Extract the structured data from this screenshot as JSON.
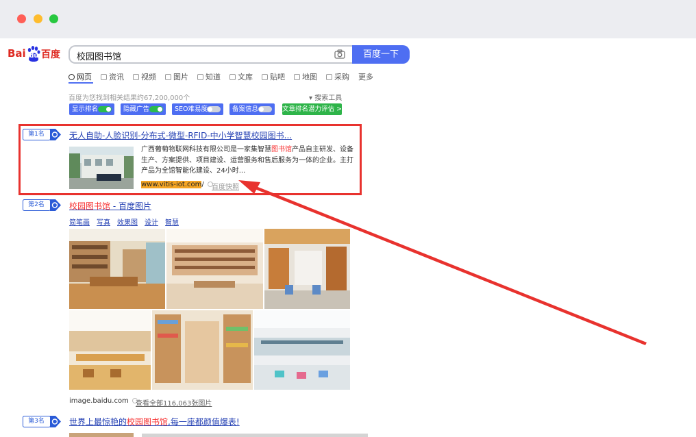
{
  "window": {
    "controls": [
      "close",
      "minimize",
      "zoom"
    ]
  },
  "logo": {
    "text_bai": "Bai",
    "text_du": "du",
    "text_baidu_cn": "百度"
  },
  "search": {
    "query": "校园图书馆",
    "button_label": "百度一下"
  },
  "tabs": [
    {
      "label": "网页",
      "active": true
    },
    {
      "label": "资讯"
    },
    {
      "label": "视频"
    },
    {
      "label": "图片"
    },
    {
      "label": "知道"
    },
    {
      "label": "文库"
    },
    {
      "label": "贴吧"
    },
    {
      "label": "地图"
    },
    {
      "label": "采购"
    },
    {
      "label": "更多"
    }
  ],
  "results_info": {
    "count_text": "百度为您找到相关结果约67,200,000个",
    "tools_label": "搜索工具"
  },
  "plugin_toolbar": {
    "toggles": [
      {
        "label": "显示排名",
        "state": "on"
      },
      {
        "label": "隐藏广告",
        "state": "on"
      },
      {
        "label": "SEO难易度",
        "state": "off"
      },
      {
        "label": "备案信息",
        "state": "off"
      }
    ],
    "evaluate_label": "文章排名潜力评估 >"
  },
  "results": [
    {
      "rank": "第1名",
      "title": "无人自助-人脸识别-分布式-微型-RFID-中小学智慧校园图书...",
      "snippet_pre": "广西葡萄物联网科技有限公司是一家集智慧",
      "snippet_em": "图书馆",
      "snippet_post": "产品自主研发、设备生产、方案提供、项目建设、运营服务和售后服务为一体的企业。主打产品为全馆智能化建设、24小时...",
      "url": "www.vitis-iot.com",
      "url_suffix": "/",
      "snapshot": "百度快照"
    },
    {
      "rank": "第2名",
      "title_em": "校园图书馆",
      "title_rest": " - 百度图片",
      "subtabs": [
        "简笔画",
        "写真",
        "效果图",
        "设计",
        "智慧"
      ],
      "source": "image.baidu.com",
      "view_all": "查看全部116,063张图片"
    },
    {
      "rank": "第3名",
      "title_pre": "世界上最惊艳的",
      "title_em": "校园图书馆",
      "title_post": ",每一座都颜值爆表!"
    }
  ],
  "colors": {
    "brand_blue": "#4e6ef2",
    "link_blue": "#2440b3",
    "highlight_red": "#f73131",
    "annotation_red": "#e8322e",
    "toggle_green": "#2bbb4f"
  }
}
